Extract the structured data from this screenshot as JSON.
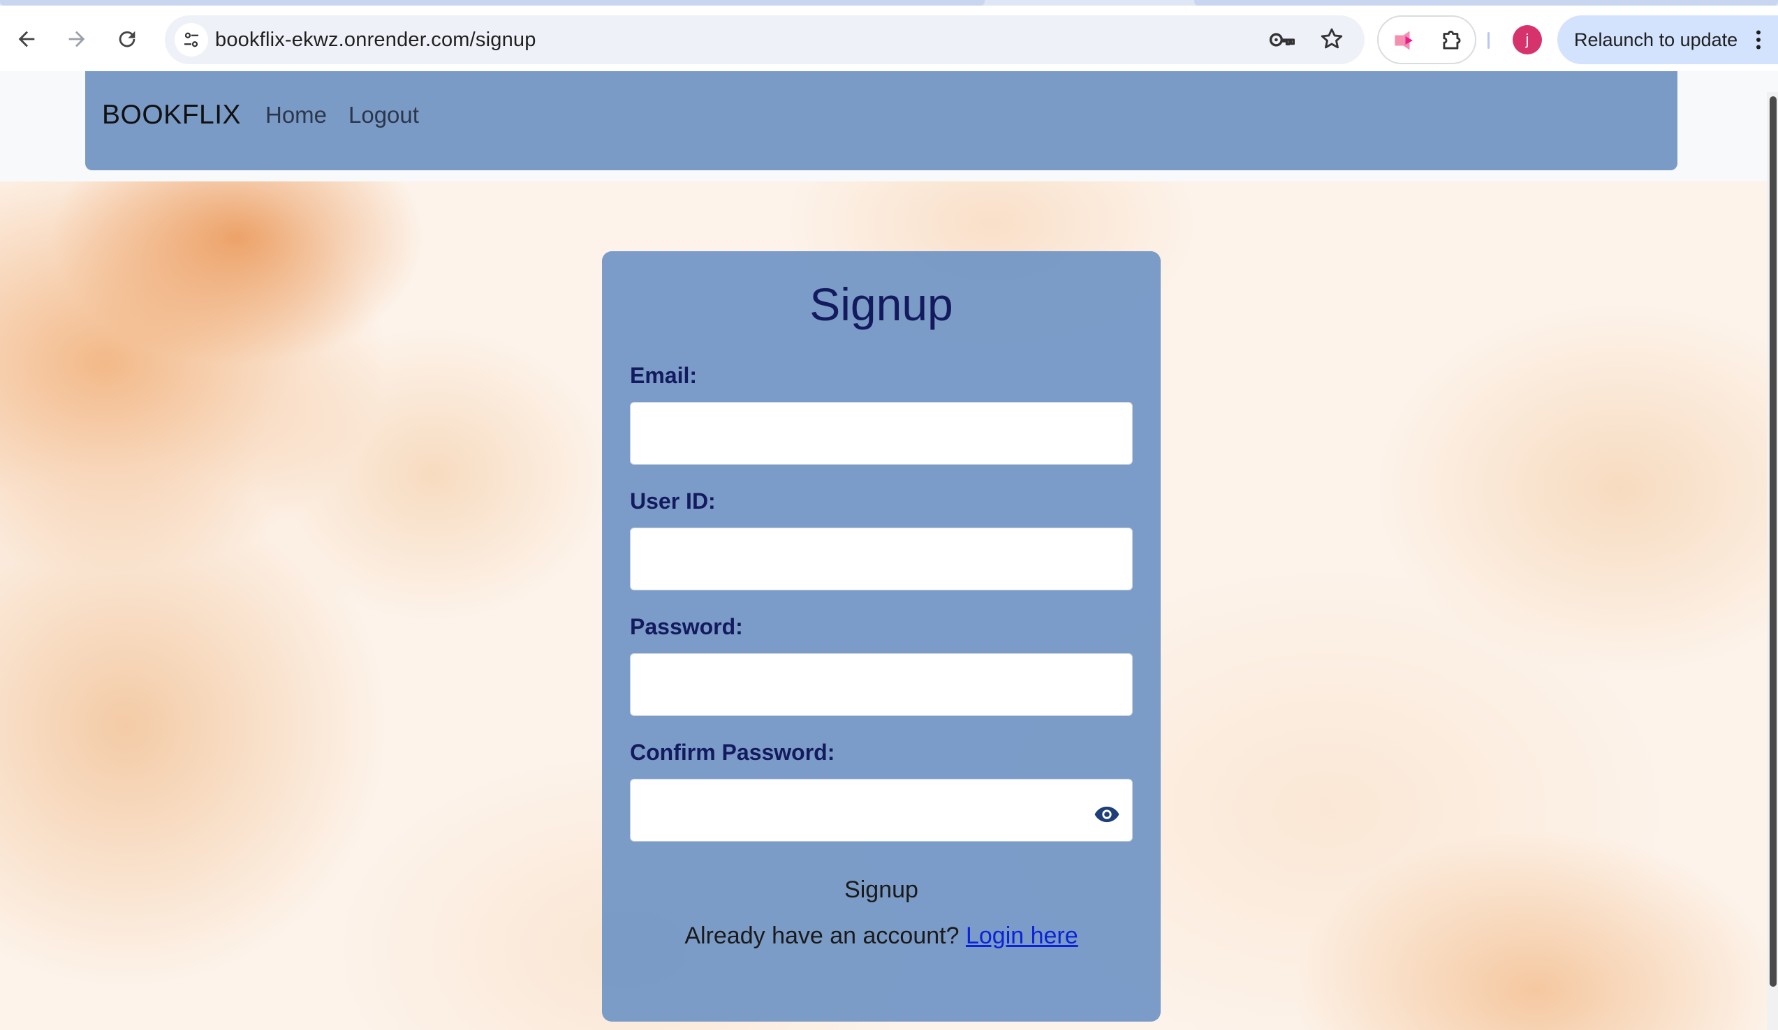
{
  "browser": {
    "url": "bookflix-ekwz.onrender.com/signup",
    "profile_initial": "j",
    "relaunch_label": "Relaunch to update"
  },
  "icons": {
    "back": "back-arrow-icon",
    "forward": "forward-arrow-icon",
    "reload": "reload-icon",
    "site_info": "tune-icon",
    "password": "key-icon",
    "bookmark": "star-icon",
    "extension_a": "extension-arrow-icon",
    "extensions": "puzzle-icon",
    "menu": "more-vert-icon",
    "show_password": "eye-icon"
  },
  "navbar": {
    "brand": "BOOKFLIX",
    "links": [
      "Home",
      "Logout"
    ]
  },
  "form": {
    "title": "Signup",
    "fields": [
      {
        "label": "Email:",
        "value": ""
      },
      {
        "label": "User ID:",
        "value": ""
      },
      {
        "label": "Password:",
        "value": ""
      },
      {
        "label": "Confirm Password:",
        "value": ""
      }
    ],
    "submit_label": "Signup",
    "account_prompt": "Already have an account?",
    "login_link": "Login here"
  },
  "colors": {
    "navbar_bg": "#7b9bc7",
    "card_bg": "#7698c6",
    "heading_text": "#141a5e",
    "link": "#0b24d8",
    "relaunch_bg": "#d3e3fd",
    "avatar_bg": "#d6336c"
  }
}
